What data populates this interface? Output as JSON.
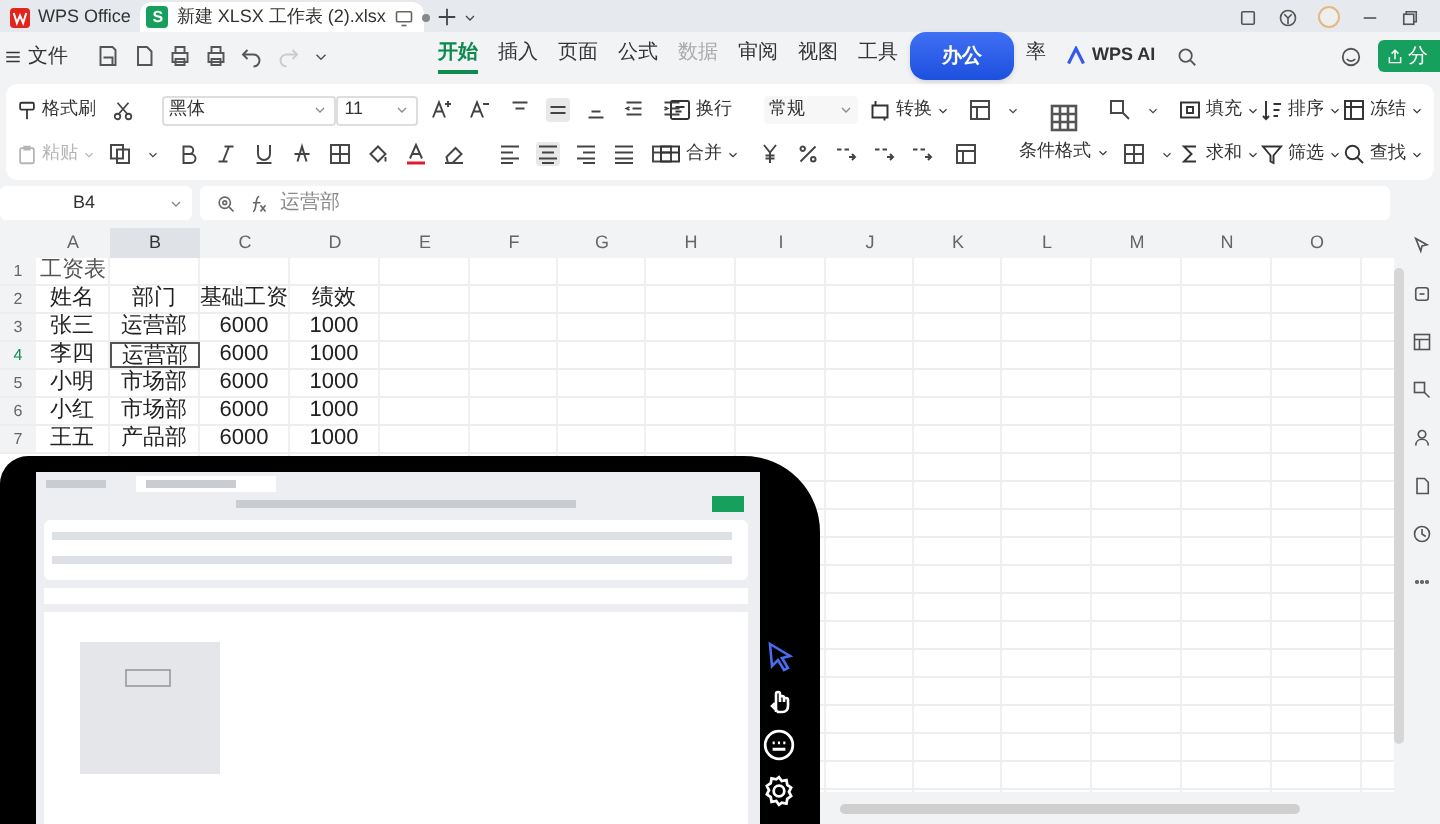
{
  "tabs": [
    {
      "kind": "home",
      "label": "WPS Office",
      "selected": false
    },
    {
      "kind": "doc",
      "label": "新建 XLSX 工作表 (2).xlsx",
      "icon_letter": "S",
      "selected": true
    }
  ],
  "menu": {
    "file": "文件",
    "items": [
      {
        "kind": "tab",
        "label": "开始",
        "selected": true
      },
      {
        "kind": "tab",
        "label": "插入",
        "selected": false
      },
      {
        "kind": "tab",
        "label": "页面",
        "selected": false
      },
      {
        "kind": "tab",
        "label": "公式",
        "selected": false
      },
      {
        "kind": "tab",
        "label": "数据",
        "selected": false,
        "disabled": true
      },
      {
        "kind": "tab",
        "label": "审阅",
        "selected": false
      },
      {
        "kind": "tab",
        "label": "视图",
        "selected": false
      },
      {
        "kind": "tab",
        "label": "工具",
        "selected": false
      },
      {
        "kind": "floating_button",
        "label": "办公"
      },
      {
        "kind": "tab",
        "label": "率",
        "selected": false
      },
      {
        "kind": "ai",
        "label": "WPS AI"
      }
    ],
    "share": "分"
  },
  "ribbon": {
    "format_painter": "格式刷",
    "paste": {
      "label": "粘贴",
      "disabled": true
    },
    "font_name": "黑体",
    "font_size": "11",
    "wrap_text": "换行",
    "merge": "合并",
    "number_format": "常规",
    "convert": "转换",
    "conditional_format": "条件格式",
    "fill": "填充",
    "sort": "排序",
    "freeze": "冻结",
    "sum": "求和",
    "filter": "筛选",
    "find": "查找"
  },
  "formula_bar": {
    "cell": "B4",
    "value": "运营部"
  },
  "sheet": {
    "columns": [
      {
        "label": "A",
        "selected": false
      },
      {
        "label": "B",
        "selected": true
      },
      {
        "label": "C",
        "selected": false
      },
      {
        "label": "D",
        "selected": false
      },
      {
        "label": "E",
        "selected": false
      },
      {
        "label": "F",
        "selected": false
      },
      {
        "label": "G",
        "selected": false
      },
      {
        "label": "H",
        "selected": false
      },
      {
        "label": "I",
        "selected": false
      },
      {
        "label": "J",
        "selected": false
      },
      {
        "label": "K",
        "selected": false
      },
      {
        "label": "L",
        "selected": false
      },
      {
        "label": "M",
        "selected": false
      },
      {
        "label": "N",
        "selected": false
      },
      {
        "label": "O",
        "selected": false
      }
    ],
    "rows": [
      {
        "number": "1",
        "selected": false,
        "kind": "title",
        "cells": [
          {
            "text": "工资表",
            "selected": false
          }
        ]
      },
      {
        "number": "2",
        "selected": false,
        "kind": "data",
        "cells": [
          {
            "text": "姓名",
            "selected": false
          },
          {
            "text": "部门",
            "selected": false
          },
          {
            "text": "基础工资",
            "selected": false
          },
          {
            "text": "绩效",
            "selected": false
          }
        ]
      },
      {
        "number": "3",
        "selected": false,
        "kind": "data",
        "cells": [
          {
            "text": "张三",
            "selected": false
          },
          {
            "text": "运营部",
            "selected": false
          },
          {
            "text": "6000",
            "selected": false
          },
          {
            "text": "1000",
            "selected": false
          }
        ]
      },
      {
        "number": "4",
        "selected": true,
        "kind": "data",
        "cells": [
          {
            "text": "李四",
            "selected": false
          },
          {
            "text": "运营部",
            "selected": true
          },
          {
            "text": "6000",
            "selected": false
          },
          {
            "text": "1000",
            "selected": false
          }
        ]
      },
      {
        "number": "5",
        "selected": false,
        "kind": "data",
        "cells": [
          {
            "text": "小明",
            "selected": false
          },
          {
            "text": "市场部",
            "selected": false
          },
          {
            "text": "6000",
            "selected": false
          },
          {
            "text": "1000",
            "selected": false
          }
        ]
      },
      {
        "number": "6",
        "selected": false,
        "kind": "data",
        "cells": [
          {
            "text": "小红",
            "selected": false
          },
          {
            "text": "市场部",
            "selected": false
          },
          {
            "text": "6000",
            "selected": false
          },
          {
            "text": "1000",
            "selected": false
          }
        ]
      },
      {
        "number": "7",
        "selected": false,
        "kind": "data",
        "cells": [
          {
            "text": "王五",
            "selected": false
          },
          {
            "text": "产品部",
            "selected": false
          },
          {
            "text": "6000",
            "selected": false
          },
          {
            "text": "1000",
            "selected": false
          }
        ]
      }
    ]
  }
}
